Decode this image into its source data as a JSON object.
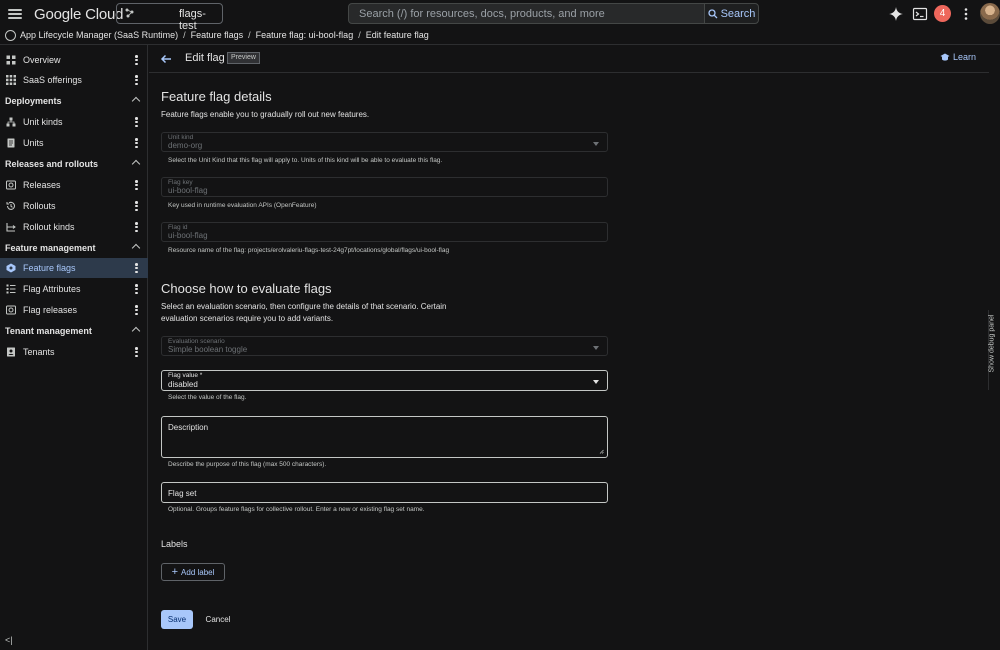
{
  "topbar": {
    "logo": "Google Cloud",
    "project": "flags-test",
    "search_placeholder": "Search (/) for resources, docs, products, and more",
    "search_button": "Search",
    "notifications_count": "4"
  },
  "breadcrumb": {
    "items": [
      "App Lifecycle Manager (SaaS Runtime)",
      "Feature flags",
      "Feature flag: ui-bool-flag",
      "Edit feature flag"
    ]
  },
  "sidebar": {
    "overview": "Overview",
    "saas_offerings": "SaaS offerings",
    "deployments": "Deployments",
    "unit_kinds": "Unit kinds",
    "units": "Units",
    "releases_rollouts": "Releases and rollouts",
    "releases": "Releases",
    "rollouts": "Rollouts",
    "rollout_kinds": "Rollout kinds",
    "feature_management": "Feature management",
    "feature_flags": "Feature flags",
    "flag_attributes": "Flag Attributes",
    "flag_releases": "Flag releases",
    "tenant_management": "Tenant management",
    "tenants": "Tenants"
  },
  "header": {
    "title": "Edit flag",
    "badge": "Preview",
    "learn": "Learn"
  },
  "details": {
    "heading": "Feature flag details",
    "description": "Feature flags enable you to gradually roll out new features.",
    "unit_kind_label": "Unit kind",
    "unit_kind_value": "demo-org",
    "unit_kind_help": "Select the Unit Kind that this flag will apply to. Units of this kind will be able to evaluate this flag.",
    "flag_key_label": "Flag key",
    "flag_key_value": "ui-bool-flag",
    "flag_key_help": "Key used in runtime evaluation APIs (OpenFeature)",
    "flag_id_label": "Flag id",
    "flag_id_value": "ui-bool-flag",
    "flag_id_help": "Resource name of the flag: projects/erolvaleriu-flags-test-24g7pt/locations/global/flags/ui-bool-flag"
  },
  "evaluate": {
    "heading": "Choose how to evaluate flags",
    "description_line1": "Select an evaluation scenario, then configure the details of that scenario. Certain",
    "description_line2": "evaluation scenarios require you to add variants.",
    "scenario_label": "Evaluation scenario",
    "scenario_value": "Simple boolean toggle",
    "flag_value_label": "Flag value *",
    "flag_value_value": "disabled",
    "flag_value_help": "Select the value of the flag.",
    "description_field_label": "Description",
    "description_field_help": "Describe the purpose of this flag (max 500 characters).",
    "flag_set_label": "Flag set",
    "flag_set_help": "Optional. Groups feature flags for collective rollout. Enter a new or existing flag set name."
  },
  "labels": {
    "heading": "Labels",
    "add_label": "Add label"
  },
  "actions": {
    "save": "Save",
    "cancel": "Cancel"
  },
  "debug_panel": "Show debug panel"
}
